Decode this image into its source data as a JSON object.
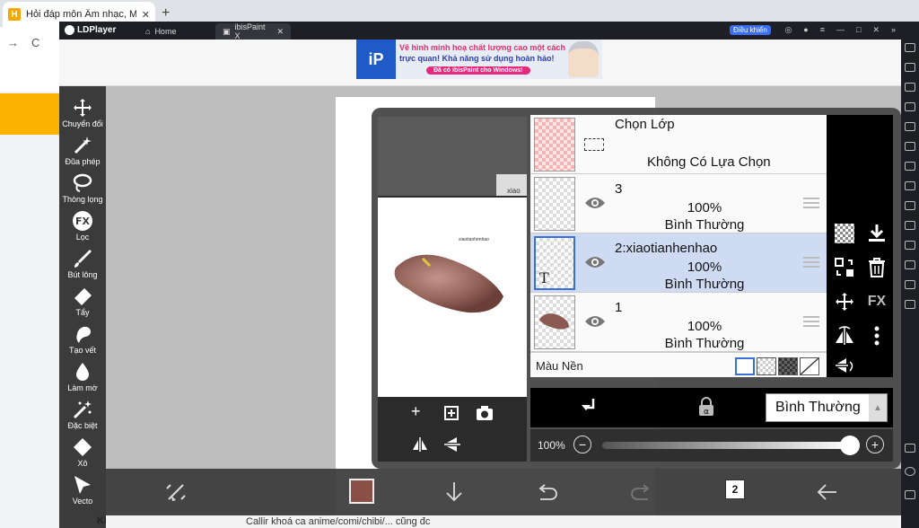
{
  "browser": {
    "tab_title": "Hỏi đáp môn Âm nhạc, Mỹ thu",
    "tab_close": "✕",
    "new_tab": "+",
    "back": "→",
    "reload": "C"
  },
  "ldplayer": {
    "brand": "LDPlayer",
    "tabs": [
      {
        "label": "Home"
      },
      {
        "label": "ibisPaint X"
      }
    ],
    "boost_label": "Điều khiển"
  },
  "ad": {
    "logo": "iP",
    "line1": "Vẽ hình minh hoạ chất lượng cao một cách",
    "line2": "trực quan! Khả năng sử dụng hoàn hảo!",
    "line3": "Đã có ibisPaint cho Windows!"
  },
  "tools": [
    {
      "label": "Chuyển đổi",
      "icon": "move-icon"
    },
    {
      "label": "Đũa phép",
      "icon": "magic-wand-icon"
    },
    {
      "label": "Thòng lọng",
      "icon": "lasso-icon"
    },
    {
      "label": "Lọc",
      "icon": "fx-icon"
    },
    {
      "label": "Bút lông",
      "icon": "brush-icon"
    },
    {
      "label": "Tẩy",
      "icon": "eraser-icon"
    },
    {
      "label": "Tạo vết",
      "icon": "smudge-icon"
    },
    {
      "label": "Làm mờ",
      "icon": "blur-icon"
    },
    {
      "label": "Đặc biệt",
      "icon": "special-icon"
    },
    {
      "label": "Xô",
      "icon": "bucket-icon"
    },
    {
      "label": "Vecto",
      "icon": "vector-icon"
    }
  ],
  "preview": {
    "text": "xiaotianhenhao",
    "text_partial": "xiao",
    "add": "+"
  },
  "layers": {
    "selection": {
      "title": "Chọn Lớp",
      "status": "Không Có Lựa Chọn"
    },
    "items": [
      {
        "name": "3",
        "opacity": "100%",
        "mode": "Bình Thường",
        "type": "empty"
      },
      {
        "name": "2:xiaotianhenhao",
        "opacity": "100%",
        "mode": "Bình Thường",
        "type": "text",
        "selected": true
      },
      {
        "name": "1",
        "opacity": "100%",
        "mode": "Bình Thường",
        "type": "image"
      }
    ],
    "background_label": "Màu Nền",
    "blend_mode": "Bình Thường",
    "opacity_label": "100%",
    "opacity_value": 1.0
  },
  "text_layer_marker": "T",
  "layer_tool_labels": {
    "fx": "FX"
  },
  "bottom": {
    "current_color": "#8a4f47",
    "layer_count": "2"
  },
  "footer": {
    "khtn": "KHTN",
    "text": "Callir khoá ca anime/comi/chibi/... cũng đc"
  }
}
